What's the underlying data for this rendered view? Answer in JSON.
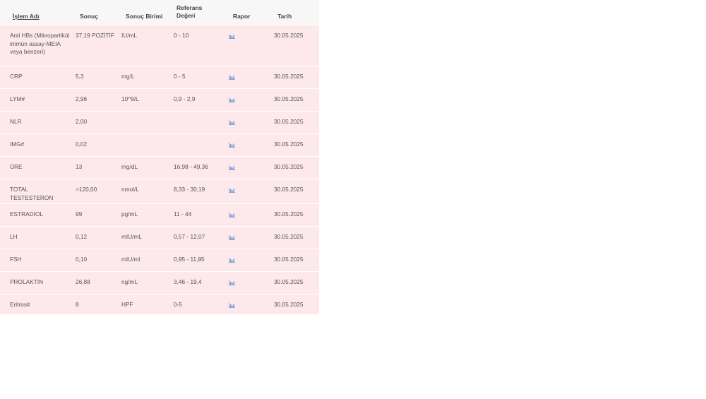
{
  "table": {
    "headers": {
      "name": "İşlem Adı",
      "result": "Sonuç",
      "unit": "Sonuç Birimi",
      "reference": "Referans Değeri",
      "report": "Rapor",
      "date": "Tarih"
    },
    "report_icon": "bar-chart-icon",
    "rows": [
      {
        "name": "Anti HBs (Mikropartikül immün assay-MEIA veya benzeri)",
        "result": "37,19 POZİTİF",
        "unit": "IU/mL",
        "reference": "0 - 10",
        "date": "30.05.2025"
      },
      {
        "name": "CRP",
        "result": "5,3",
        "unit": "mg/L",
        "reference": "0 - 5",
        "date": "30.05.2025"
      },
      {
        "name": "LYM#",
        "result": "2,96",
        "unit": "10^9/L",
        "reference": "0,9 - 2,9",
        "date": "30.05.2025"
      },
      {
        "name": "NLR",
        "result": "2,00",
        "unit": "",
        "reference": "",
        "date": "30.05.2025"
      },
      {
        "name": "IMG#",
        "result": "0,02",
        "unit": "",
        "reference": "",
        "date": "30.05.2025"
      },
      {
        "name": "ÜRE",
        "result": "13",
        "unit": "mg/dL",
        "reference": "16,98 - 49,36",
        "date": "30.05.2025"
      },
      {
        "name": "TOTAL TESTESTERON",
        "result": ">120,00",
        "unit": "nmol/L",
        "reference": "8,33 - 30,19",
        "date": "30.05.2025"
      },
      {
        "name": "ESTRADIOL",
        "result": "99",
        "unit": "pg/mL",
        "reference": "11 - 44",
        "date": "30.05.2025"
      },
      {
        "name": "LH",
        "result": "0,12",
        "unit": "mIU/mL",
        "reference": "0,57 - 12,07",
        "date": "30.05.2025"
      },
      {
        "name": "FSH",
        "result": "0,10",
        "unit": "mIU/ml",
        "reference": "0,95 - 11,95",
        "date": "30.05.2025"
      },
      {
        "name": "PROLAKTIN",
        "result": "26,88",
        "unit": "ng/mL",
        "reference": "3,46 - 19,4",
        "date": "30.05.2025"
      },
      {
        "name": "Eritrosit",
        "result": "8",
        "unit": "HPF",
        "reference": "0-5",
        "date": "30.05.2025"
      }
    ]
  }
}
